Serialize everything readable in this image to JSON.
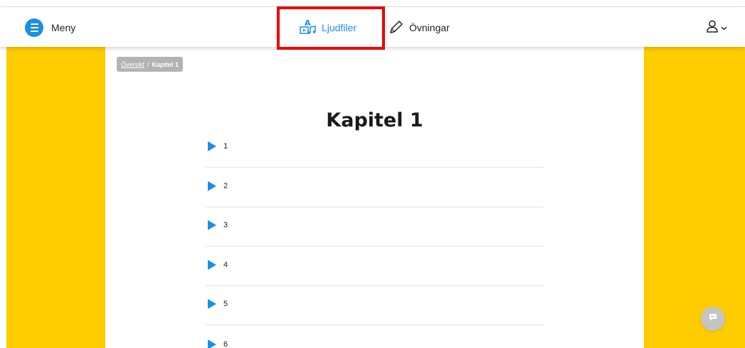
{
  "navbar": {
    "menu_label": "Meny",
    "tabs": [
      {
        "label": "Ljudfiler",
        "icon": "audio-files-icon",
        "active": true
      },
      {
        "label": "Övningar",
        "icon": "pencil-icon",
        "active": false
      }
    ],
    "user_icon": "user-icon"
  },
  "breadcrumb": {
    "parent": "Översikt",
    "separator": "/",
    "current": "Kapitel 1"
  },
  "page": {
    "title": "Kapitel 1"
  },
  "tracks": [
    "1",
    "2",
    "3",
    "4",
    "5",
    "6"
  ],
  "colors": {
    "accent": "#1a8fe3",
    "side_background": "#ffcc00",
    "highlight": "#ee0000",
    "breadcrumb_bg": "#b3b3b3",
    "chat_button": "#c4c4c4"
  }
}
